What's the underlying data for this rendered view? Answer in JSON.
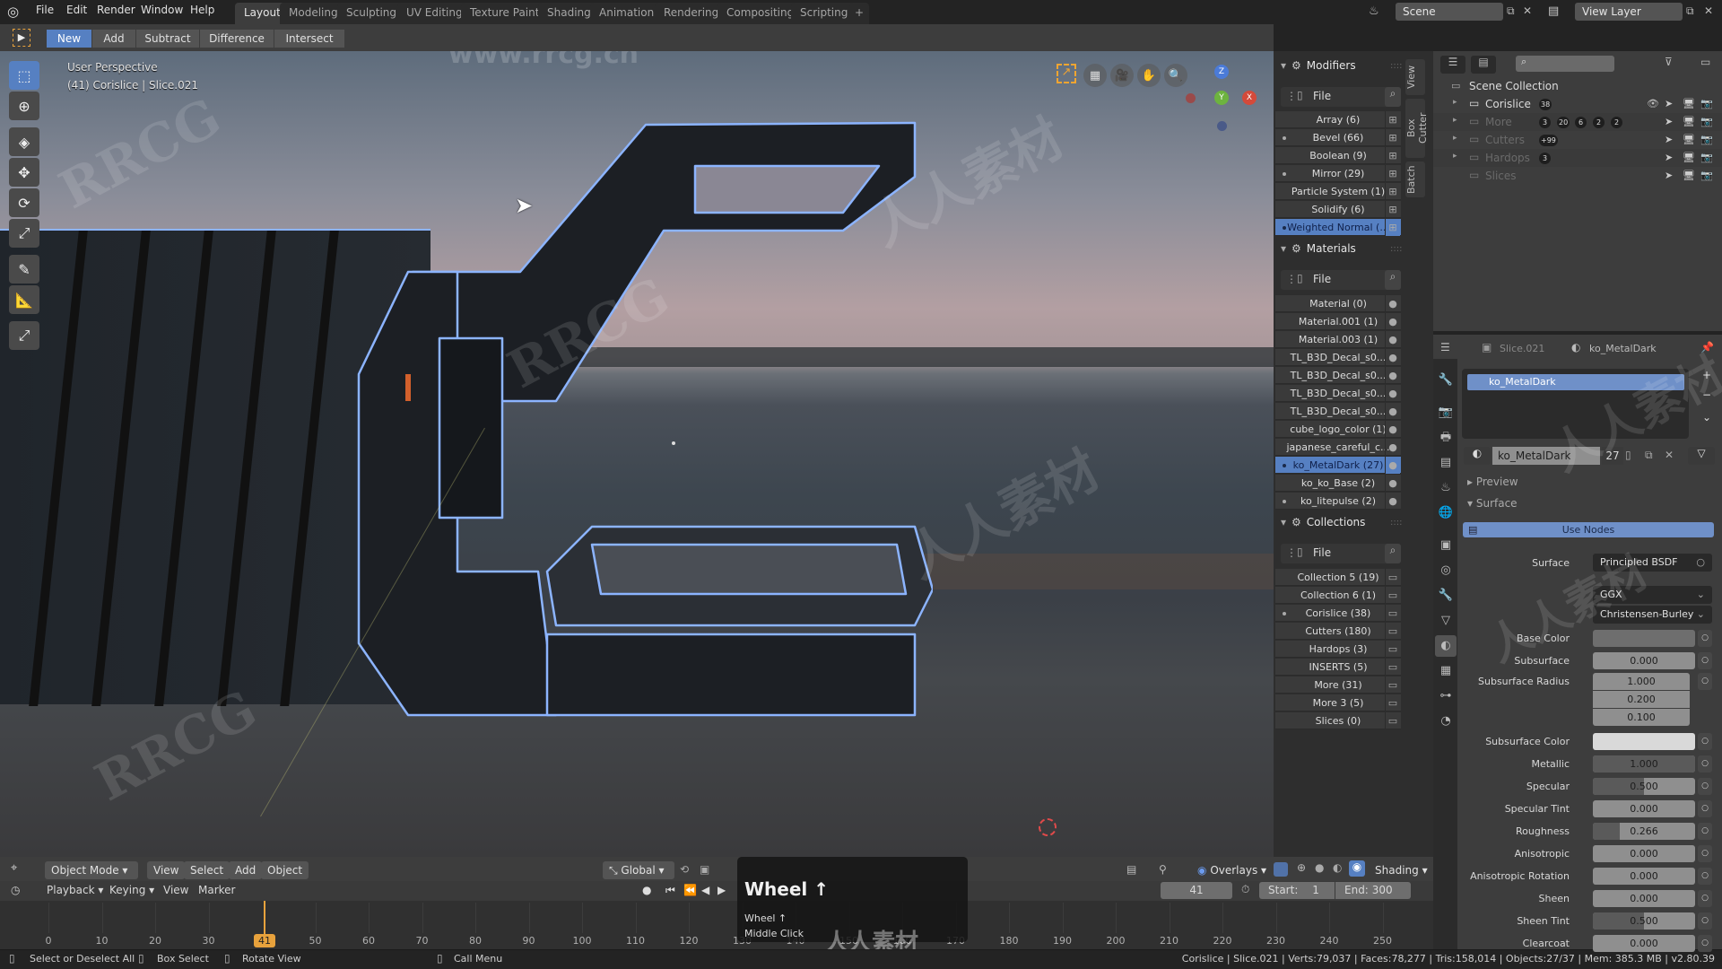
{
  "menu": {
    "items": [
      "File",
      "Edit",
      "Render",
      "Window",
      "Help"
    ],
    "workspace_tabs": [
      "Layout",
      "Modeling",
      "Sculpting",
      "UV Editing",
      "Texture Paint",
      "Shading",
      "Animation",
      "Rendering",
      "Compositing",
      "Scripting"
    ],
    "active_tab": "Layout",
    "add_tab": "+",
    "scene": "Scene",
    "view_layer": "View Layer"
  },
  "tool_header": {
    "buttons": [
      "New",
      "Add",
      "Subtract",
      "Difference",
      "Intersect"
    ],
    "active": "New"
  },
  "viewport": {
    "perspective": "User Perspective",
    "object_info": "(41) Corislice | Slice.021",
    "gizmo_axes": [
      "Z",
      "Y",
      "X"
    ],
    "accent_outline": "#7aa7ff"
  },
  "viewport_header": {
    "mode": "Object Mode",
    "menus": [
      "View",
      "Select",
      "Add",
      "Object"
    ],
    "orientation": "Global",
    "overlays": "Overlays",
    "shading": "Shading"
  },
  "timeline": {
    "menus": [
      "Playback",
      "Keying",
      "View",
      "Marker"
    ],
    "current_frame": "41",
    "start_label": "Start:",
    "start": "1",
    "end_label": "End:",
    "end": "300",
    "ticks": [
      "0",
      "10",
      "20",
      "30",
      "41",
      "50",
      "60",
      "70",
      "80",
      "90",
      "100",
      "110",
      "120",
      "130",
      "140",
      "150",
      "160",
      "170",
      "180",
      "190",
      "200",
      "210",
      "220",
      "230",
      "240",
      "250"
    ],
    "playhead_color": "#e8a23c"
  },
  "key_popup": {
    "title": "Wheel ↑",
    "lines": [
      "Wheel ↑",
      "Middle Click"
    ]
  },
  "statusbar": {
    "hints": [
      "Select or Deselect All",
      "Box Select",
      "Rotate View",
      "Call Menu"
    ],
    "stats": "Corislice | Slice.021 | Verts:79,037 | Faces:78,277 | Tris:158,014 | Objects:27/37 | Mem: 385.3 MB | v2.80.39"
  },
  "side_panel": {
    "tabs": [
      "View",
      "Box Cutter",
      "Batch"
    ],
    "modifiers": {
      "title": "Modifiers",
      "filter": "File",
      "items": [
        {
          "label": "Array (6)",
          "dot": false
        },
        {
          "label": "Bevel (66)",
          "dot": true
        },
        {
          "label": "Boolean (9)",
          "dot": false
        },
        {
          "label": "Mirror (29)",
          "dot": true
        },
        {
          "label": "Particle System (1)",
          "dot": false
        },
        {
          "label": "Solidify (6)",
          "dot": false
        },
        {
          "label": "Weighted Normal (...",
          "dot": true,
          "selected": true
        }
      ]
    },
    "materials": {
      "title": "Materials",
      "filter": "File",
      "items": [
        {
          "label": "Material (0)",
          "dot": false
        },
        {
          "label": "Material.001 (1)",
          "dot": false
        },
        {
          "label": "Material.003 (1)",
          "dot": false
        },
        {
          "label": "TL_B3D_Decal_s0...",
          "dot": false
        },
        {
          "label": "TL_B3D_Decal_s0...",
          "dot": false
        },
        {
          "label": "TL_B3D_Decal_s0...",
          "dot": false
        },
        {
          "label": "TL_B3D_Decal_s0...",
          "dot": false
        },
        {
          "label": "cube_logo_color (1)",
          "dot": false
        },
        {
          "label": "japanese_careful_c...",
          "dot": false
        },
        {
          "label": "ko_MetalDark (27)",
          "dot": true,
          "selected": true
        },
        {
          "label": "ko_ko_Base (2)",
          "dot": false
        },
        {
          "label": "ko_litepulse (2)",
          "dot": true
        }
      ]
    },
    "collections": {
      "title": "Collections",
      "filter": "File",
      "items": [
        {
          "label": "Collection 5 (19)",
          "dot": false
        },
        {
          "label": "Collection 6 (1)",
          "dot": false
        },
        {
          "label": "Corislice (38)",
          "dot": true
        },
        {
          "label": "Cutters (180)",
          "dot": false
        },
        {
          "label": "Hardops (3)",
          "dot": false
        },
        {
          "label": "INSERTS (5)",
          "dot": false
        },
        {
          "label": "More (31)",
          "dot": false
        },
        {
          "label": "More 3 (5)",
          "dot": false
        },
        {
          "label": "Slices (0)",
          "dot": false
        }
      ]
    }
  },
  "outliner": {
    "root": "Scene Collection",
    "rows": [
      {
        "label": "Corislice",
        "badges": [
          "38"
        ]
      },
      {
        "label": "More",
        "badges": [
          "3",
          "20",
          "6",
          "2",
          "2"
        ]
      },
      {
        "label": "Cutters",
        "badges": [
          "+99"
        ]
      },
      {
        "label": "Hardops",
        "badges": [
          "3"
        ]
      },
      {
        "label": "Slices",
        "badges": []
      }
    ]
  },
  "properties": {
    "breadcrumb_object": "Slice.021",
    "breadcrumb_material": "ko_MetalDark",
    "slot": "ko_MetalDark",
    "material_name": "ko_MetalDark",
    "users": "27",
    "sections": {
      "preview": "Preview",
      "surface": "Surface"
    },
    "use_nodes": "Use Nodes",
    "surface_label": "Surface",
    "surface_shader": "Principled BSDF",
    "distribution": "GGX",
    "subsurface_method": "Christensen-Burley",
    "fields": [
      {
        "label": "Base Color",
        "type": "color",
        "color": "#6e6e6e"
      },
      {
        "label": "Subsurface",
        "value": "0.000",
        "fraction": 0
      },
      {
        "label": "Subsurface Radius",
        "values": [
          "1.000",
          "0.200",
          "0.100"
        ]
      },
      {
        "label": "Subsurface Color",
        "type": "color",
        "color": "#d9d9d9"
      },
      {
        "label": "Metallic",
        "value": "1.000",
        "fraction": 1.0
      },
      {
        "label": "Specular",
        "value": "0.500",
        "fraction": 0.5
      },
      {
        "label": "Specular Tint",
        "value": "0.000",
        "fraction": 0
      },
      {
        "label": "Roughness",
        "value": "0.266",
        "fraction": 0.266
      },
      {
        "label": "Anisotropic",
        "value": "0.000",
        "fraction": 0
      },
      {
        "label": "Anisotropic Rotation",
        "value": "0.000",
        "fraction": 0
      },
      {
        "label": "Sheen",
        "value": "0.000",
        "fraction": 0
      },
      {
        "label": "Sheen Tint",
        "value": "0.500",
        "fraction": 0.5
      },
      {
        "label": "Clearcoat",
        "value": "0.000",
        "fraction": 0
      }
    ]
  },
  "watermarks": [
    "RRCG",
    "人人素材",
    "www.rrcg.cn"
  ]
}
